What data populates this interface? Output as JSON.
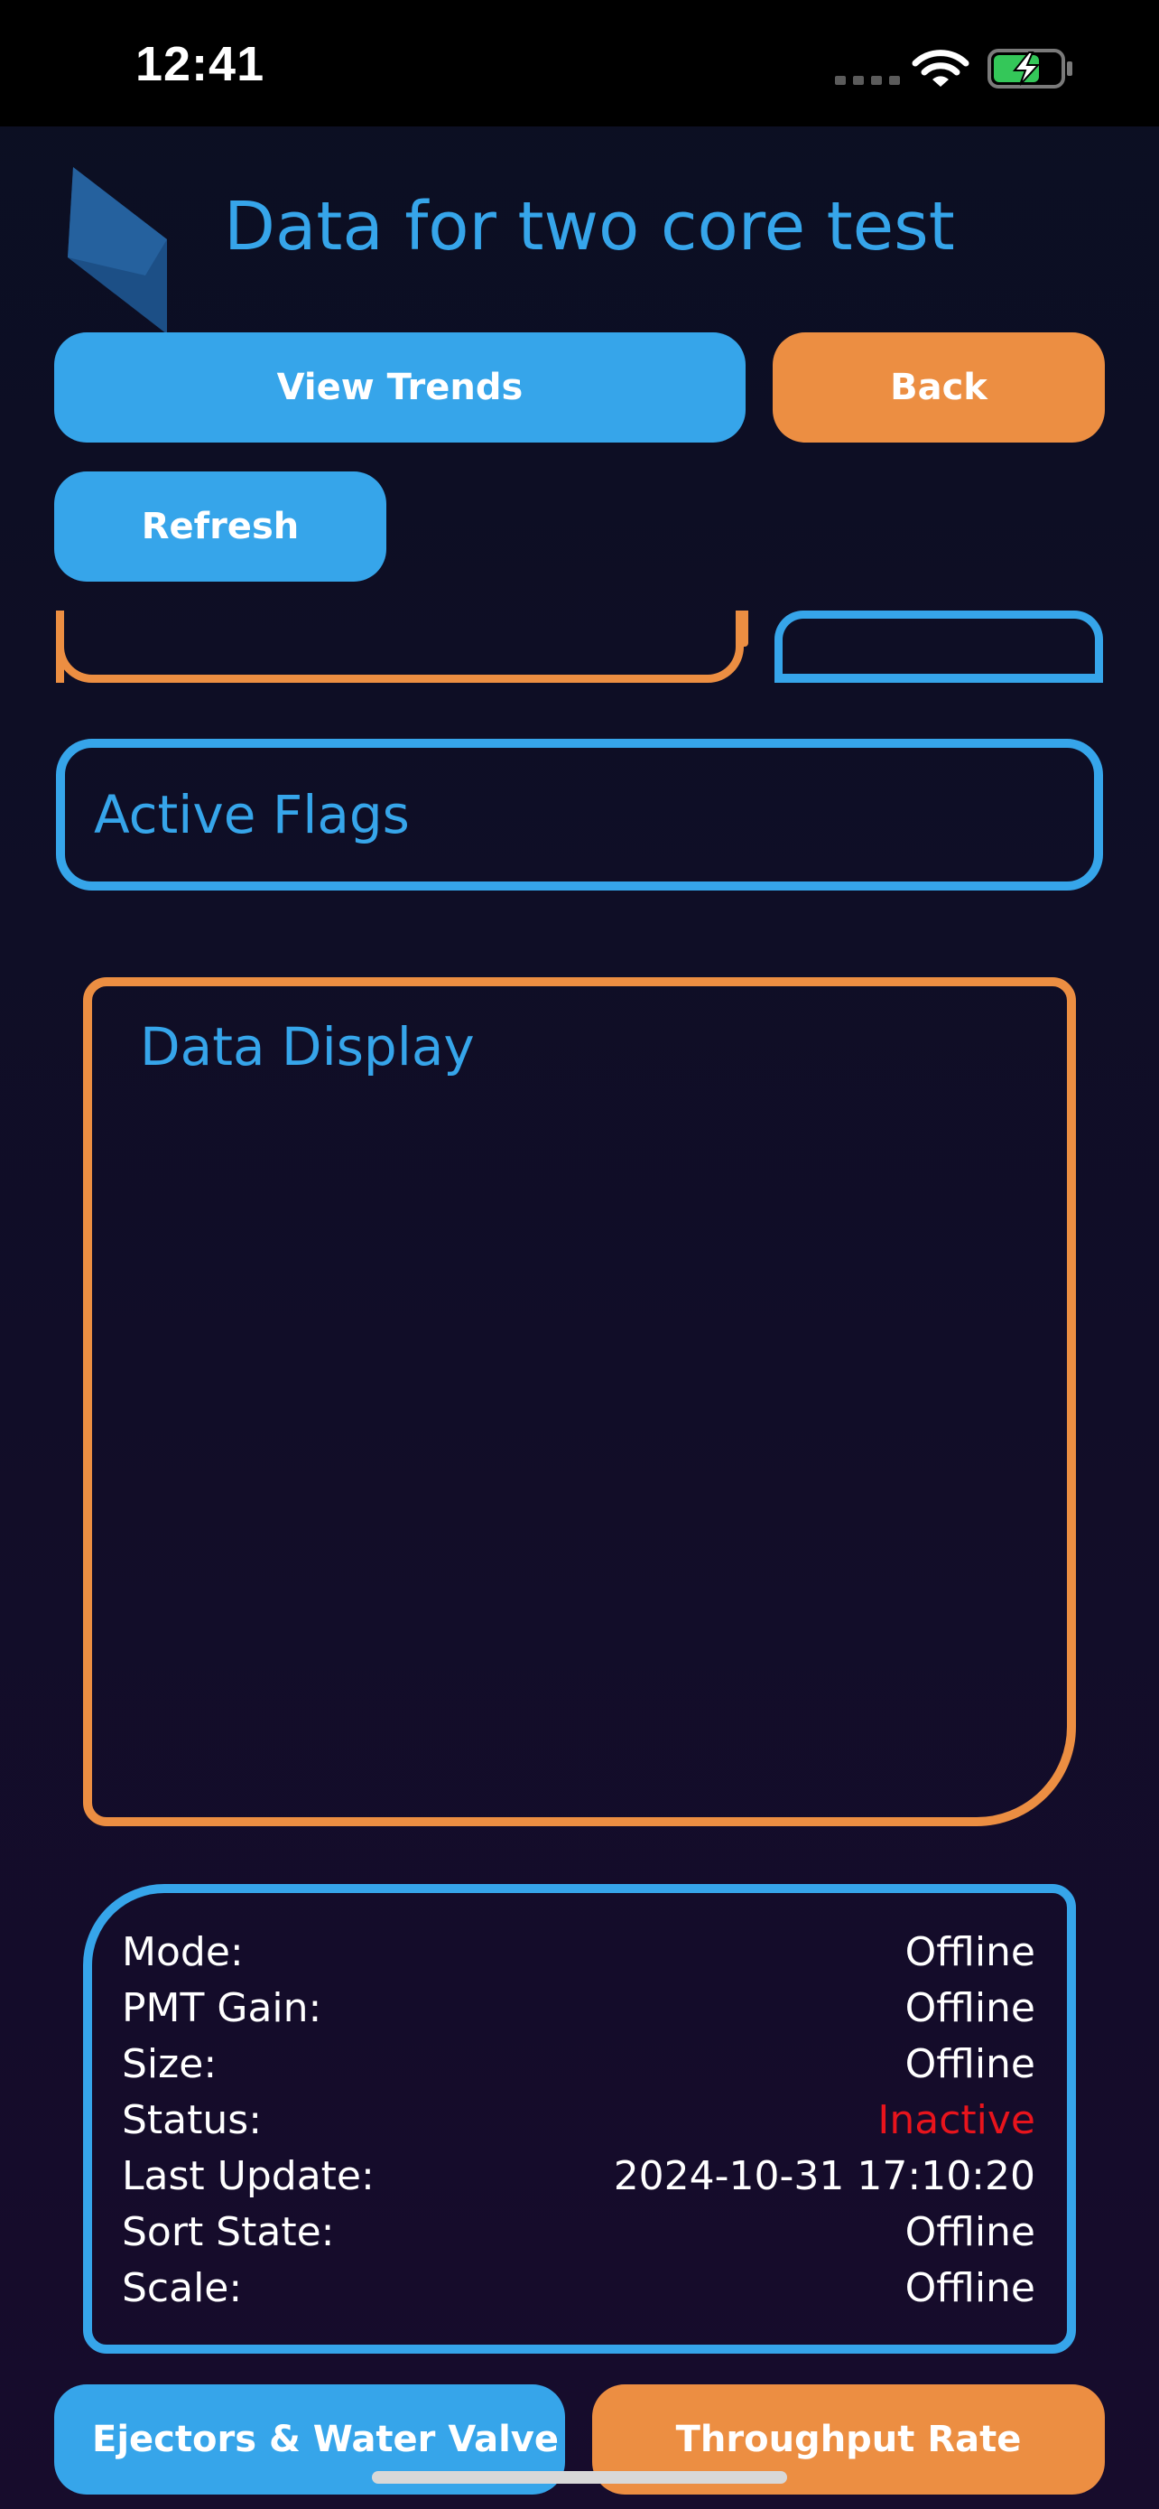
{
  "status_bar": {
    "time": "12:41"
  },
  "header": {
    "title": "Data for two core test"
  },
  "buttons": {
    "view_trends": "View Trends",
    "back": "Back",
    "refresh": "Refresh",
    "ejectors": "Ejectors & Water Valve",
    "throughput": "Throughput Rate"
  },
  "sections": {
    "active_flags": "Active Flags",
    "data_display": "Data Display"
  },
  "info": {
    "rows": [
      {
        "label": "Mode:",
        "value": "Offline"
      },
      {
        "label": "PMT Gain:",
        "value": "Offline"
      },
      {
        "label": "Size:",
        "value": "Offline"
      },
      {
        "label": "Status:",
        "value": "Inactive"
      },
      {
        "label": "Last Update:",
        "value": "2024-10-31 17:10:20"
      },
      {
        "label": "Sort State:",
        "value": "Offline"
      },
      {
        "label": "Scale:",
        "value": "Offline"
      }
    ]
  },
  "colors": {
    "accent_blue": "#36a5ea",
    "accent_orange": "#ec8e42",
    "status_inactive": "#e8141c",
    "battery_green": "#34c759"
  },
  "icons": [
    "wifi-icon",
    "battery-charging-icon",
    "signal-icon",
    "app-logo"
  ]
}
